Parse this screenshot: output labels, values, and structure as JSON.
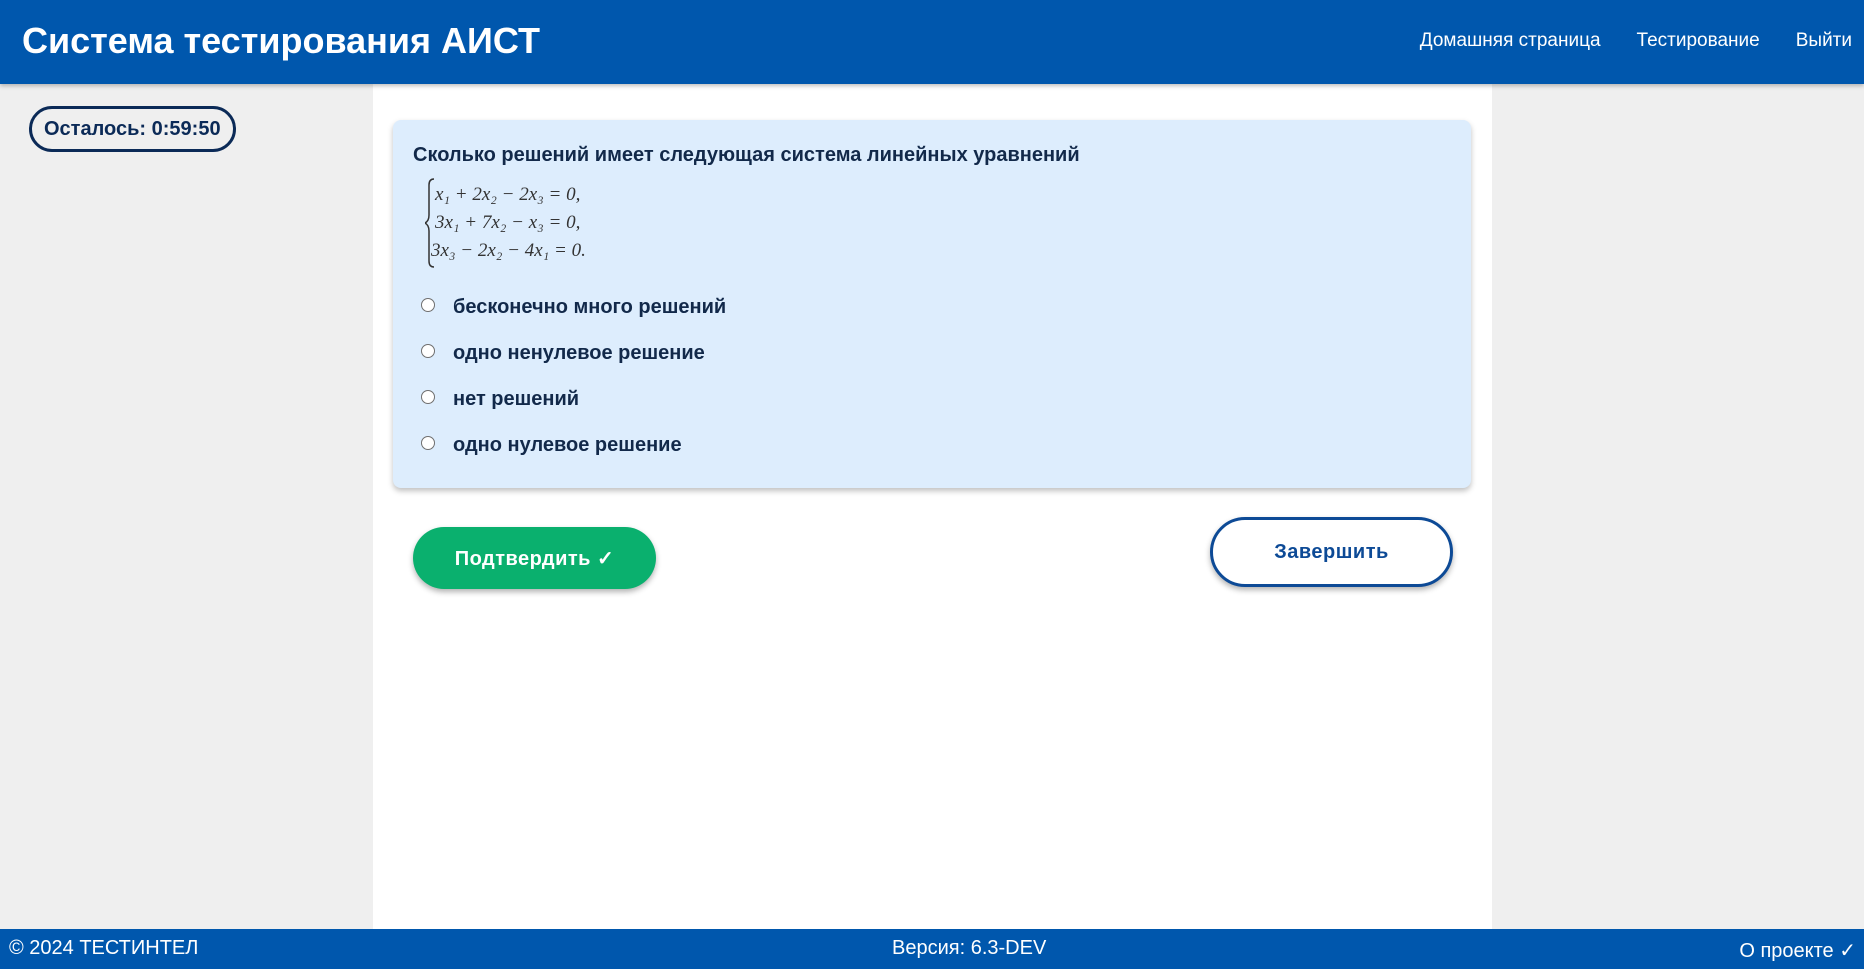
{
  "header": {
    "title": "Система тестирования АИСТ",
    "nav": [
      {
        "label": "Домашняя страница"
      },
      {
        "label": "Тестирование"
      },
      {
        "label": "Выйти"
      }
    ]
  },
  "timer": {
    "text": "Осталось: 0:59:50"
  },
  "question": {
    "text": "Сколько решений имеет следующая система линейных уравнений",
    "equations": [
      "x₁ + 2x₂ − 2x₃ = 0,",
      "3x₁ + 7x₂ − x₃ = 0,",
      "3x₃ − 2x₂ − 4x₁ = 0."
    ],
    "options": [
      {
        "label": "бесконечно много решений",
        "selected": false
      },
      {
        "label": "одно ненулевое решение",
        "selected": false
      },
      {
        "label": "нет решений",
        "selected": false
      },
      {
        "label": "одно нулевое решение",
        "selected": false
      }
    ]
  },
  "actions": {
    "confirm_label": "Подтвердить ✓",
    "finish_label": "Завершить"
  },
  "footer": {
    "copyright": "© 2024 ТЕСТИНТЕЛ",
    "version": "Версия: 6.3-DEV",
    "about": "О проекте ✓"
  },
  "colors": {
    "header_bg": "#0057ad",
    "card_bg": "#ddedfd",
    "confirm_bg": "#0ab06e",
    "finish_border": "#0d4a96",
    "text_dark": "#12294a"
  }
}
